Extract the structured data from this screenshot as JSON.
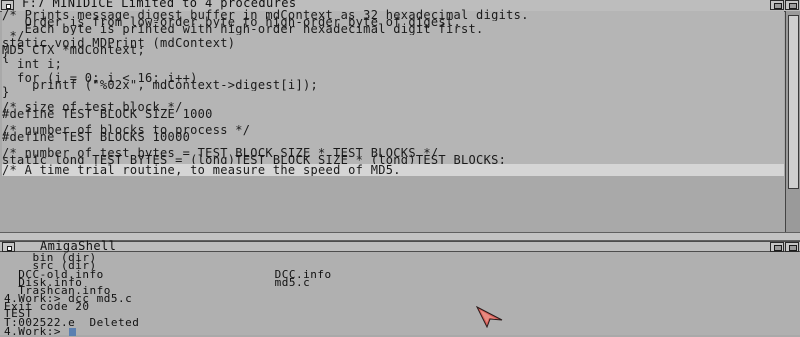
{
  "editor": {
    "title": "F:7 MINIDICE Limited to 4 procedures",
    "lines": [
      "/* Prints message digest buffer in mdContext as 32 hexadecimal digits.",
      "   Order is from low-order byte to high-order byte of digest.",
      "   Each byte is printed with high-order hexadecimal digit first.",
      " */",
      "static void MDPrint (mdContext)",
      "MD5_CTX *mdContext;",
      "{",
      "  int i;",
      "",
      "  for (i = 0; i < 16; i++)",
      "    printf (\"%02x\", mdContext->digest[i]);",
      "}",
      "",
      "/* size of test block */",
      "#define TEST_BLOCK_SIZE 1000",
      "",
      "/* number of blocks to process */",
      "#define TEST_BLOCKS 10000",
      "",
      "/* number of test bytes = TEST_BLOCK_SIZE * TEST_BLOCKS */",
      "static long TEST_BYTES = (long)TEST_BLOCK_SIZE * (long)TEST_BLOCKS;",
      "",
      "/* A time trial routine, to measure the speed of MD5."
    ],
    "selected_line": 22
  },
  "shell": {
    "title": "AmigaShell",
    "lines": [
      "    bin (dir)",
      "    src (dir)",
      "  DCC-old.info                        DCC.info",
      "  Disk.info                           md5.c",
      "  Trashcan.info",
      "4.Work:> dcc md5.c",
      "Exit code 20",
      "TEST",
      "T:002522.e  Deleted"
    ],
    "prompt": "4.Work:> "
  },
  "icons": {
    "close": "close-gadget-icon",
    "depth": "depth-gadget-icon",
    "pointer": "mouse-pointer-icon"
  },
  "colors": {
    "background": "#a9a9a9",
    "pointer_fill": "#d8605a",
    "cursor": "#5b7fb0"
  }
}
